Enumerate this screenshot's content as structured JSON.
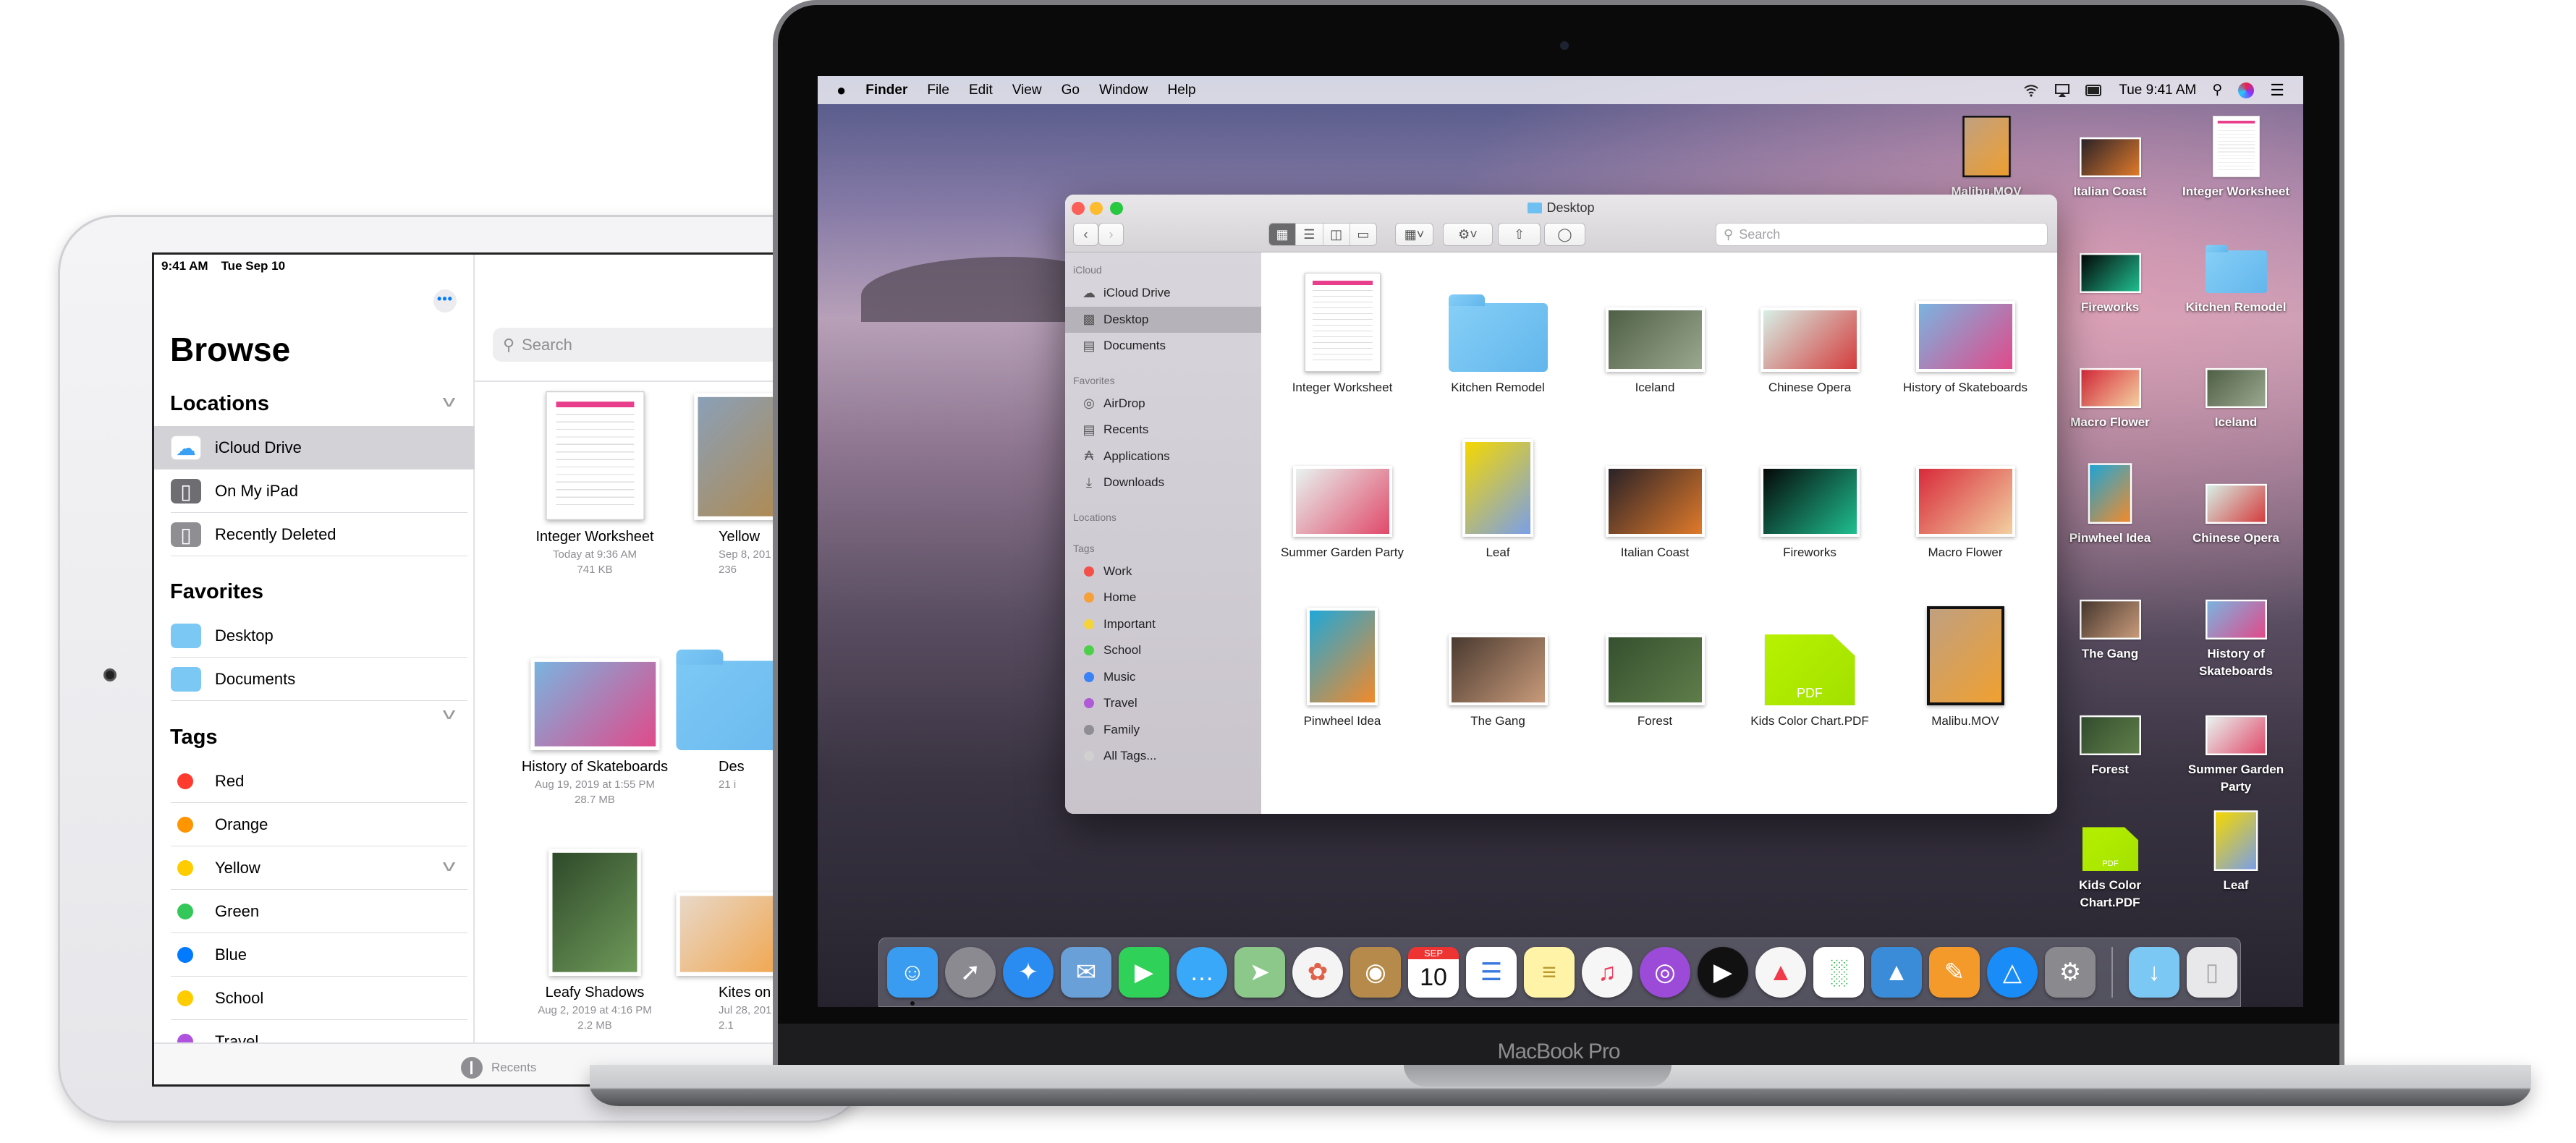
{
  "ipad": {
    "status_time": "9:41 AM",
    "status_date": "Tue Sep 10",
    "more_label": "•••",
    "title": "Browse",
    "locations": {
      "label": "Locations",
      "items": [
        {
          "label": "iCloud Drive",
          "icon": "icloud-icon",
          "selected": true
        },
        {
          "label": "On My iPad",
          "icon": "ipad-icon"
        },
        {
          "label": "Recently Deleted",
          "icon": "trash-icon"
        }
      ]
    },
    "favorites": {
      "label": "Favorites",
      "items": [
        {
          "label": "Desktop",
          "icon": "folder-icon"
        },
        {
          "label": "Documents",
          "icon": "folder-icon"
        }
      ]
    },
    "tags": {
      "label": "Tags",
      "items": [
        {
          "label": "Red",
          "color": "#ff3b30"
        },
        {
          "label": "Orange",
          "color": "#ff9500"
        },
        {
          "label": "Yellow",
          "color": "#ffcc00"
        },
        {
          "label": "Green",
          "color": "#34c759"
        },
        {
          "label": "Blue",
          "color": "#007aff"
        },
        {
          "label": "School",
          "color": "#ffcc00"
        },
        {
          "label": "Travel",
          "color": "#af52de"
        }
      ]
    },
    "search_placeholder": "Search",
    "files": [
      {
        "name": "Integer Worksheet",
        "date": "Today at 9:36 AM",
        "size": "741 KB",
        "kind": "doc",
        "thumb": [
          "#ffffff",
          "#e83e8c"
        ]
      },
      {
        "name": "Yellow",
        "date": "Sep 8, 201",
        "size": "236",
        "kind": "port",
        "thumb": [
          "#8aa0b8",
          "#b08a50"
        ]
      },
      {
        "name": "History of Skateboards",
        "date": "Aug 19, 2019 at 1:55 PM",
        "size": "28.7 MB",
        "kind": "land2",
        "thumb": [
          "#7ab4e0",
          "#e04a8a"
        ]
      },
      {
        "name": "Des",
        "date": "21 i",
        "size": "",
        "kind": "folder",
        "thumb": [
          "#7cc8f5",
          "#6ab8ee"
        ]
      },
      {
        "name": "Leafy Shadows",
        "date": "Aug 2, 2019 at 4:16 PM",
        "size": "2.2 MB",
        "kind": "port",
        "thumb": [
          "#2f4a2a",
          "#6f9a5a"
        ]
      },
      {
        "name": "Kites on",
        "date": "Jul 28, 201",
        "size": "2.1",
        "kind": "land",
        "thumb": [
          "#e8d8c8",
          "#f2a040"
        ]
      }
    ],
    "tabbar": {
      "recents": "Recents"
    }
  },
  "mac": {
    "menubar": {
      "menus": [
        "Finder",
        "File",
        "Edit",
        "View",
        "Go",
        "Window",
        "Help"
      ],
      "clock": "Tue 9:41 AM"
    },
    "finder": {
      "title": "Desktop",
      "search_placeholder": "Search",
      "sidebar": [
        {
          "header": "iCloud",
          "items": [
            {
              "label": "iCloud Drive",
              "icon": "cloud-icon"
            },
            {
              "label": "Desktop",
              "icon": "desktop-icon",
              "selected": true
            },
            {
              "label": "Documents",
              "icon": "documents-icon"
            }
          ]
        },
        {
          "header": "Favorites",
          "items": [
            {
              "label": "AirDrop",
              "icon": "airdrop-icon"
            },
            {
              "label": "Recents",
              "icon": "recents-icon"
            },
            {
              "label": "Applications",
              "icon": "applications-icon"
            },
            {
              "label": "Downloads",
              "icon": "downloads-icon"
            }
          ]
        },
        {
          "header": "Locations",
          "items": []
        },
        {
          "header": "Tags",
          "items": [
            {
              "label": "Work",
              "color": "#f4504a"
            },
            {
              "label": "Home",
              "color": "#f5a03a"
            },
            {
              "label": "Important",
              "color": "#f5d33a"
            },
            {
              "label": "School",
              "color": "#4cd04a"
            },
            {
              "label": "Music",
              "color": "#3b82f6"
            },
            {
              "label": "Travel",
              "color": "#b05ad8"
            },
            {
              "label": "Family",
              "color": "#8e8e93"
            },
            {
              "label": "All Tags...",
              "color": "#d0d0d0"
            }
          ]
        }
      ],
      "files": [
        {
          "name": "Integer Worksheet",
          "kind": "doc",
          "thumb": [
            "#ffffff",
            "#e83e8c"
          ]
        },
        {
          "name": "Kitchen Remodel",
          "kind": "folder",
          "thumb": [
            "#86cff7",
            "#62b6ec"
          ]
        },
        {
          "name": "Iceland",
          "kind": "land",
          "thumb": [
            "#4f5f45",
            "#9aa890"
          ]
        },
        {
          "name": "Chinese Opera",
          "kind": "land",
          "thumb": [
            "#d6efe6",
            "#d43c3c"
          ]
        },
        {
          "name": "History of Skateboards",
          "kind": "land2",
          "thumb": [
            "#7ab4e0",
            "#e04a8a"
          ]
        },
        {
          "name": "Summer Garden Party",
          "kind": "land2",
          "thumb": [
            "#e8f3f0",
            "#e04a6a"
          ]
        },
        {
          "name": "Leaf",
          "kind": "port",
          "thumb": [
            "#f5d800",
            "#7a9fe8"
          ]
        },
        {
          "name": "Italian Coast",
          "kind": "land2",
          "thumb": [
            "#2a2228",
            "#e07a2a"
          ]
        },
        {
          "name": "Fireworks",
          "kind": "land2",
          "thumb": [
            "#050808",
            "#1fbf8f"
          ]
        },
        {
          "name": "Macro Flower",
          "kind": "land2",
          "thumb": [
            "#d82a3a",
            "#f2d0a0"
          ]
        },
        {
          "name": "Pinwheel Idea",
          "kind": "port",
          "thumb": [
            "#1fa8d8",
            "#f28a2a"
          ]
        },
        {
          "name": "The Gang",
          "kind": "land2",
          "thumb": [
            "#4a3a30",
            "#c89a7a"
          ]
        },
        {
          "name": "Forest",
          "kind": "land2",
          "thumb": [
            "#34502f",
            "#5f7d4a"
          ]
        },
        {
          "name": "Kids Color Chart.PDF",
          "kind": "pdf",
          "badge": "PDF",
          "thumb": [
            "#b8f200",
            "#a2e000"
          ]
        },
        {
          "name": "Malibu.MOV",
          "kind": "video",
          "thumb": [
            "#c0a080",
            "#f0a030"
          ]
        }
      ]
    },
    "desktop_icons": [
      {
        "name": "Malibu.MOV",
        "kind": "video",
        "thumb": [
          "#c0a080",
          "#f0a030"
        ]
      },
      {
        "name": "Italian Coast",
        "kind": "land",
        "thumb": [
          "#2a2228",
          "#e07a2a"
        ]
      },
      {
        "name": "Fireworks",
        "kind": "land",
        "thumb": [
          "#050808",
          "#1fbf8f"
        ]
      },
      {
        "name": "Macro Flower",
        "kind": "land",
        "thumb": [
          "#d82a3a",
          "#f2d0a0"
        ]
      },
      {
        "name": "Pinwheel Idea",
        "kind": "port",
        "thumb": [
          "#1fa8d8",
          "#f28a2a"
        ]
      },
      {
        "name": "The Gang",
        "kind": "land",
        "thumb": [
          "#4a3a30",
          "#c89a7a"
        ]
      },
      {
        "name": "Forest",
        "kind": "land",
        "thumb": [
          "#34502f",
          "#5f7d4a"
        ]
      },
      {
        "name": "Kids Color Chart.PDF",
        "kind": "pdf",
        "badge": "PDF",
        "thumb": [
          "#b8f200",
          "#a2e000"
        ]
      },
      {
        "name": "Integer Worksheet",
        "kind": "doc",
        "thumb": [
          "#ffffff",
          "#e83e8c"
        ]
      },
      {
        "name": "Kitchen Remodel",
        "kind": "folder",
        "thumb": [
          "#86cff7",
          "#62b6ec"
        ]
      },
      {
        "name": "Iceland",
        "kind": "land",
        "thumb": [
          "#4f5f45",
          "#9aa890"
        ]
      },
      {
        "name": "Chinese Opera",
        "kind": "land",
        "thumb": [
          "#d6efe6",
          "#d43c3c"
        ]
      },
      {
        "name": "History of Skateboards",
        "kind": "land",
        "thumb": [
          "#7ab4e0",
          "#e04a8a"
        ]
      },
      {
        "name": "Summer Garden Party",
        "kind": "land",
        "thumb": [
          "#e8f3f0",
          "#e04a6a"
        ]
      },
      {
        "name": "Leaf",
        "kind": "port",
        "thumb": [
          "#f5d800",
          "#7a9fe8"
        ]
      }
    ],
    "dock": {
      "apps": [
        {
          "name": "Finder",
          "icon": "finder-icon",
          "bg": "#3a9cf0",
          "running": true
        },
        {
          "name": "Launchpad",
          "icon": "launchpad-icon",
          "bg": "#8a8a90"
        },
        {
          "name": "Safari",
          "icon": "safari-icon",
          "bg": "#2a8cf0"
        },
        {
          "name": "Mail",
          "icon": "mail-icon",
          "bg": "#6aa0d8"
        },
        {
          "name": "FaceTime",
          "icon": "facetime-icon",
          "bg": "#2fd158"
        },
        {
          "name": "Messages",
          "icon": "messages-icon",
          "bg": "#3aa8f8"
        },
        {
          "name": "Maps",
          "icon": "maps-icon",
          "bg": "#8cc88a"
        },
        {
          "name": "Photos",
          "icon": "photos-icon",
          "bg": "#f4f4f4"
        },
        {
          "name": "Contacts",
          "icon": "contacts-icon",
          "bg": "#b58a4a"
        },
        {
          "name": "Calendar",
          "icon": "calendar-icon",
          "bg": "#ffffff"
        },
        {
          "name": "Reminders",
          "icon": "reminders-icon",
          "bg": "#ffffff"
        },
        {
          "name": "Notes",
          "icon": "notes-icon",
          "bg": "#fff3a8"
        },
        {
          "name": "Music",
          "icon": "music-icon",
          "bg": "#f6f6f6"
        },
        {
          "name": "Podcasts",
          "icon": "podcasts-icon",
          "bg": "#9b4bd8"
        },
        {
          "name": "TV",
          "icon": "tv-icon",
          "bg": "#111111"
        },
        {
          "name": "News",
          "icon": "news-icon",
          "bg": "#f6f6f6"
        },
        {
          "name": "Numbers",
          "icon": "numbers-icon",
          "bg": "#ffffff"
        },
        {
          "name": "Keynote",
          "icon": "keynote-icon",
          "bg": "#3a8cd8"
        },
        {
          "name": "Pages",
          "icon": "pages-icon",
          "bg": "#f49a2a"
        },
        {
          "name": "App Store",
          "icon": "app-store-icon",
          "bg": "#1a8cf8"
        },
        {
          "name": "System Preferences",
          "icon": "system-preferences-icon",
          "bg": "#8a8a8e"
        }
      ],
      "stacks": [
        {
          "name": "Downloads",
          "icon": "downloads-folder-icon",
          "bg": "#7cc8f5"
        },
        {
          "name": "Trash",
          "icon": "trash-icon",
          "bg": "#e8e8ea"
        }
      ],
      "calendar": {
        "month": "SEP",
        "day": "10"
      }
    },
    "brand": "MacBook Pro"
  }
}
